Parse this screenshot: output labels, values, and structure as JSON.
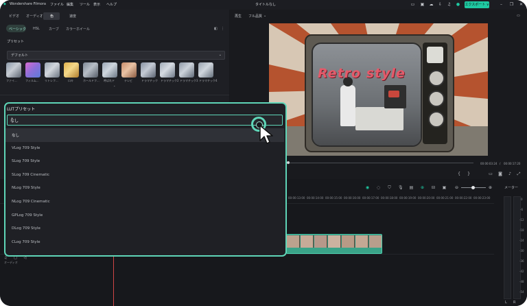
{
  "app": {
    "name": "Wondershare Filmora",
    "menu": [
      "ファイル",
      "編集",
      "ツール",
      "表示",
      "ヘルプ"
    ],
    "title": "タイトルなし",
    "export_label": "エクスポート ∨"
  },
  "media_tabs": [
    "ビデオ",
    "オーディオ",
    "色",
    "速度"
  ],
  "color_subtabs": [
    "ベーシック",
    "HSL",
    "カーブ",
    "カラーホイール"
  ],
  "preset": {
    "section_label": "プリセット",
    "selected": "デフォルト",
    "thumbnails": [
      "ファイ...",
      "フィルム...",
      "リトレフ...",
      "ロキ",
      "ホールドフ...",
      "呼ばれド",
      "テレビ",
      "ドラマチック",
      "ドラマチック2",
      "ドラマチック3",
      "ドラマチック4"
    ]
  },
  "preview": {
    "mode_label": "再生",
    "quality_label": "フル品質",
    "overlay_text": "Retro style",
    "time_current": "00:00:03:24",
    "time_total": "00:00:17:20"
  },
  "timeline": {
    "meter_label": "メーター",
    "ruler_ticks": [
      "00:00:13:00",
      "00:00:14:00",
      "00:00:15:00",
      "00:00:16:00",
      "00:00:17:00",
      "00:00:18:00",
      "00:00:19:00",
      "00:00:20:00",
      "00:00:21:00",
      "00:00:22:00",
      "00:00:23:00"
    ],
    "vu_scale": [
      "0",
      "-6",
      "-12",
      "-18",
      "-24",
      "-30",
      "-36",
      "-42",
      "-48",
      "-54"
    ],
    "vu_lr": [
      "L",
      "R"
    ],
    "audio_track_label": "オーディオ"
  },
  "lut": {
    "title": "LUTプリセット",
    "selected": "なし",
    "options": [
      "なし",
      "VLog 709 Style",
      "SLog 709 Style",
      "SLog 709 Cinematic",
      "NLog 709 Style",
      "NLog 709 Cinematic",
      "GPLog 709 Style",
      "DLog 709 Style",
      "CLog 709 Style"
    ]
  },
  "colors": {
    "accent": "#1fc9a2",
    "highlight_border": "#5fd6b8",
    "playhead": "#d24646"
  }
}
